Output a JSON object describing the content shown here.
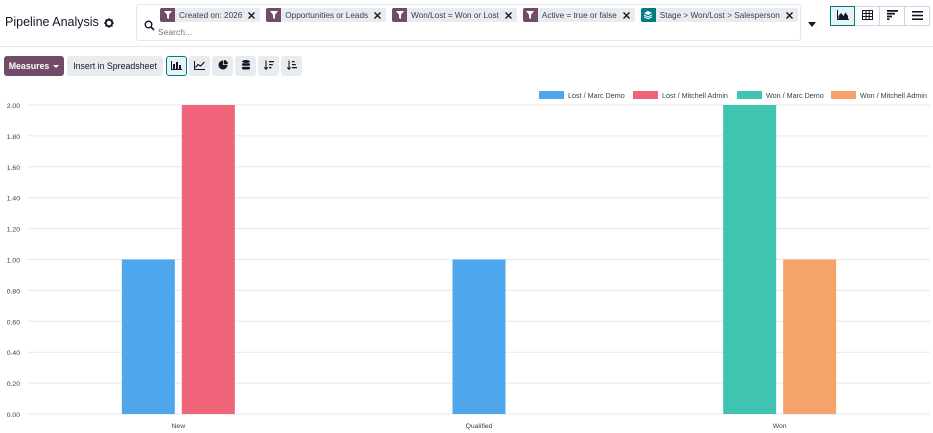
{
  "header": {
    "title": "Pipeline Analysis",
    "settings_icon": "gear-icon"
  },
  "search": {
    "placeholder": "Search...",
    "facets": [
      {
        "type": "filter",
        "label": "Created on: 2026"
      },
      {
        "type": "filter",
        "label": "Opportunities or Leads"
      },
      {
        "type": "filter",
        "label": "Won/Lost = Won or Lost"
      },
      {
        "type": "filter",
        "label": "Active = true or false"
      },
      {
        "type": "groupby",
        "label": "Stage > Won/Lost > Salesperson"
      }
    ]
  },
  "views": [
    "graph",
    "pivot",
    "cohort",
    "list"
  ],
  "active_view": "graph",
  "toolbar": {
    "measures_label": "Measures",
    "spreadsheet_label": "Insert in Spreadsheet",
    "chart_tools": [
      "bar-chart",
      "line-chart",
      "pie-chart",
      "stacked",
      "sort-descending",
      "sort-ascending"
    ],
    "active_tool": "bar-chart"
  },
  "colors": {
    "brand": "#714b67",
    "group_facet": "#017e84"
  },
  "chart_data": {
    "type": "bar",
    "categories": [
      "New",
      "Qualified",
      "Won"
    ],
    "series": [
      {
        "name": "Lost / Marc Demo",
        "color": "#4ea7ec",
        "values": [
          1,
          1,
          null
        ]
      },
      {
        "name": "Lost / Mitchell Admin",
        "color": "#ef6479",
        "values": [
          2,
          null,
          null
        ]
      },
      {
        "name": "Won / Marc Demo",
        "color": "#3fc4b2",
        "values": [
          null,
          null,
          2
        ]
      },
      {
        "name": "Won / Mitchell Admin",
        "color": "#f5a36b",
        "values": [
          null,
          null,
          1
        ]
      }
    ],
    "ylim": [
      0,
      2
    ],
    "yticks": [
      "0.00",
      "0.20",
      "0.40",
      "0.60",
      "0.80",
      "1.00",
      "1.20",
      "1.40",
      "1.60",
      "1.80",
      "2.00"
    ],
    "grid": true,
    "legend": "top-right"
  }
}
